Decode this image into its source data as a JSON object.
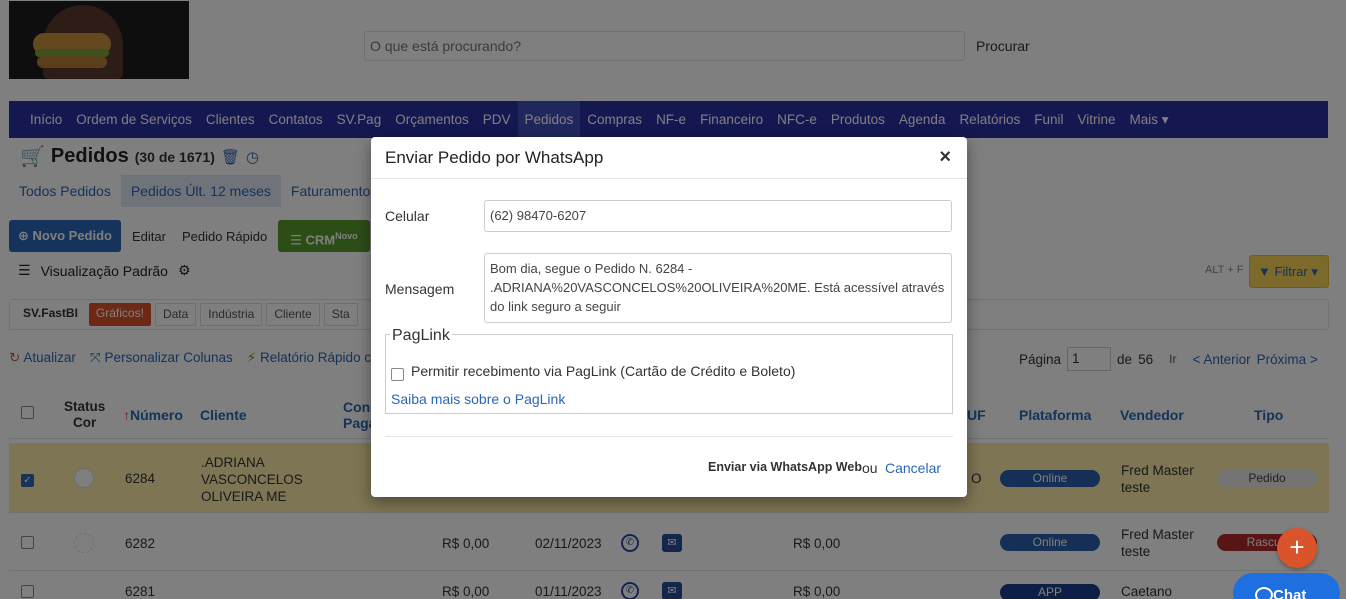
{
  "header": {
    "search_placeholder": "O que está procurando?",
    "search_button": "Procurar"
  },
  "nav": {
    "items": [
      "Início",
      "Ordem de Serviços",
      "Clientes",
      "Contatos",
      "SV.Pag",
      "Orçamentos",
      "PDV",
      "Pedidos",
      "Compras",
      "NF-e",
      "Financeiro",
      "NFC-e",
      "Produtos",
      "Agenda",
      "Relatórios",
      "Funil",
      "Vitrine",
      "Mais ▾"
    ],
    "active_index": 7
  },
  "page": {
    "title": "Pedidos",
    "count": "(30 de 1671)"
  },
  "tabs": [
    "Todos Pedidos",
    "Pedidos Últ. 12 meses",
    "Faturamento &"
  ],
  "actions": {
    "new": "Novo Pedido",
    "edit": "Editar",
    "quick": "Pedido Rápido",
    "crm": "CRM",
    "crm_badge": "Novo"
  },
  "view": {
    "label": "Visualização Padrão",
    "shortcut": "ALT + F",
    "filter": "Filtrar"
  },
  "chips": [
    "SV.FastBI",
    "Gráficos!",
    "Data",
    "Indústria",
    "Cliente",
    "Sta"
  ],
  "tools": {
    "refresh": "Atualizar",
    "customize": "Personalizar Colunas",
    "report": "Relatório Rápido c/ sel"
  },
  "pager": {
    "label": "Página",
    "value": "1",
    "of": "de",
    "total": "56",
    "go": "Ir",
    "prev": "< Anterior",
    "next": "Próxima >"
  },
  "table": {
    "headers": {
      "status": "Status",
      "cor": "Cor",
      "numero": "Número",
      "cliente": "Cliente",
      "cond": "Conc",
      "paga": "Paga",
      "uf": "UF",
      "plataforma": "Plataforma",
      "vendedor": "Vendedor",
      "tipo": "Tipo"
    },
    "rows": [
      {
        "numero": "6284",
        "cliente": ".ADRIANA VASCONCELOS OLIVEIRA ME",
        "uf": "O",
        "plataforma": "Online",
        "vendedor": "Fred Master teste",
        "tipo": "Pedido"
      },
      {
        "numero": "6282",
        "valor": "R$ 0,00",
        "data": "02/11/2023",
        "valor2": "R$ 0,00",
        "plataforma": "Online",
        "vendedor": "Fred Master teste",
        "tipo": "Rascun"
      },
      {
        "numero": "6281",
        "valor": "R$ 0,00",
        "data": "01/11/2023",
        "valor2": "R$ 0,00",
        "plataforma": "APP",
        "vendedor": "Caetano"
      }
    ]
  },
  "modal": {
    "title": "Enviar Pedido por WhatsApp",
    "close": "×",
    "celular_label": "Celular",
    "celular_value": "(62) 98470-6207",
    "mensagem_label": "Mensagem",
    "mensagem_value": "Bom dia, segue o Pedido N. 6284 - .ADRIANA%20VASCONCELOS%20OLIVEIRA%20ME. Está acessível através do link seguro a seguir",
    "paglink_legend": "PagLink",
    "paglink_checkbox": "Permitir recebimento via PagLink (Cartão de Crédito e Boleto)",
    "paglink_more": "Saiba mais sobre o PagLink",
    "send": "Enviar via WhatsApp Web",
    "or": "ou",
    "cancel": "Cancelar"
  },
  "widgets": {
    "fab": "+",
    "chat": "Chat"
  },
  "colors": {
    "navbar": "#2b2fa3",
    "primary": "#2b66b6",
    "crm": "#5a9a2e",
    "selected_row": "#fbeaa6",
    "filter": "#f8d45a"
  }
}
